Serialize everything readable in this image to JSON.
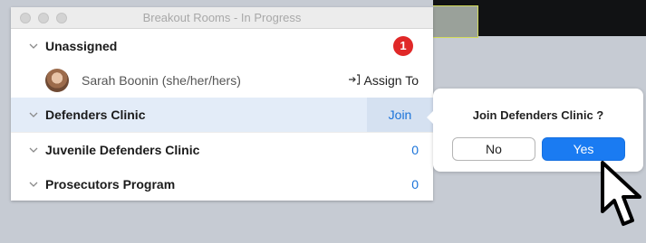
{
  "window": {
    "title": "Breakout Rooms - In Progress"
  },
  "rooms": {
    "unassigned": {
      "label": "Unassigned",
      "badge": "1",
      "member": {
        "name": "Sarah Boonin (she/her/hers)",
        "action": "Assign To"
      }
    },
    "items": [
      {
        "label": "Defenders Clinic",
        "right": "Join"
      },
      {
        "label": "Juvenile Defenders Clinic",
        "right": "0"
      },
      {
        "label": "Prosecutors Program",
        "right": "0"
      }
    ]
  },
  "dialog": {
    "question": "Join Defenders Clinic ?",
    "no_label": "No",
    "yes_label": "Yes"
  },
  "colors": {
    "accent": "#1a7bf2",
    "link": "#1a73d9",
    "badge": "#e02828",
    "selected_row": "#e3ecf8"
  },
  "icons": {
    "chevron": "chevron-down-icon",
    "assign": "assign-to-icon",
    "cursor": "mouse-pointer-icon"
  }
}
